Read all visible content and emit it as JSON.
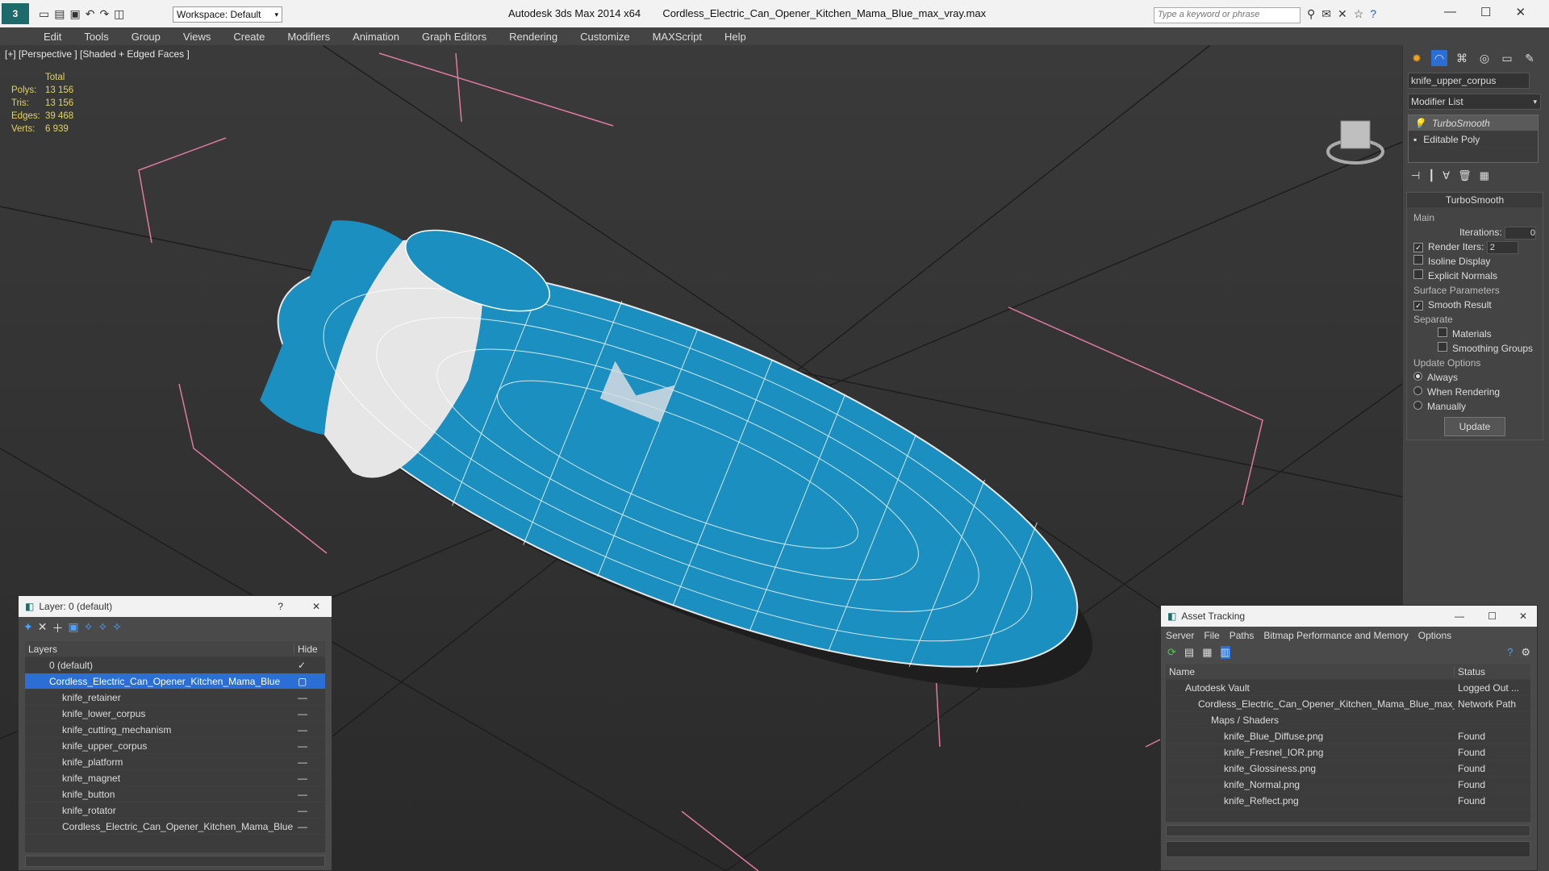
{
  "titlebar": {
    "app": "Autodesk 3ds Max  2014 x64",
    "file": "Cordless_Electric_Can_Opener_Kitchen_Mama_Blue_max_vray.max",
    "workspace": "Workspace: Default",
    "search_placeholder": "Type a keyword or phrase"
  },
  "menu": [
    "Edit",
    "Tools",
    "Group",
    "Views",
    "Create",
    "Modifiers",
    "Animation",
    "Graph Editors",
    "Rendering",
    "Customize",
    "MAXScript",
    "Help"
  ],
  "viewport": {
    "label": "[+] [Perspective ] [Shaded + Edged Faces ]",
    "stats": {
      "header": "Total",
      "rows": [
        {
          "k": "Polys:",
          "v": "13 156"
        },
        {
          "k": "Tris:",
          "v": "13 156"
        },
        {
          "k": "Edges:",
          "v": "39 468"
        },
        {
          "k": "Verts:",
          "v": "6 939"
        }
      ]
    }
  },
  "colors": {
    "accent_blue": "#1a8fc0",
    "selection": "#2b6fd6",
    "viewport_border": "#caa53a",
    "stats_text": "#e3d35a"
  },
  "cmd": {
    "object_name": "knife_upper_corpus",
    "modifier_list": "Modifier List",
    "stack": [
      "TurboSmooth",
      "Editable Poly"
    ],
    "rollout_title": "TurboSmooth",
    "main_label": "Main",
    "iterations_label": "Iterations:",
    "iterations_value": "0",
    "render_iters_label": "Render Iters:",
    "render_iters_value": "2",
    "isoline": "Isoline Display",
    "explicit": "Explicit Normals",
    "surface_params": "Surface Parameters",
    "smooth_result": "Smooth Result",
    "separate": "Separate",
    "materials": "Materials",
    "smoothing_groups": "Smoothing Groups",
    "update_options": "Update Options",
    "always": "Always",
    "when_rendering": "When Rendering",
    "manually": "Manually",
    "update_btn": "Update"
  },
  "layers": {
    "title": "Layer: 0 (default)",
    "col_layers": "Layers",
    "col_hide": "Hide",
    "items": [
      {
        "label": "0 (default)"
      },
      {
        "label": "Cordless_Electric_Can_Opener_Kitchen_Mama_Blue"
      },
      {
        "label": "knife_retainer"
      },
      {
        "label": "knife_lower_corpus"
      },
      {
        "label": "knife_cutting_mechanism"
      },
      {
        "label": "knife_upper_corpus"
      },
      {
        "label": "knife_platform"
      },
      {
        "label": "knife_magnet"
      },
      {
        "label": "knife_button"
      },
      {
        "label": "knife_rotator"
      },
      {
        "label": "Cordless_Electric_Can_Opener_Kitchen_Mama_Blue"
      }
    ]
  },
  "assets": {
    "title": "Asset Tracking",
    "menu": [
      "Server",
      "File",
      "Paths",
      "Bitmap Performance and Memory",
      "Options"
    ],
    "col_name": "Name",
    "col_status": "Status",
    "rows": [
      {
        "name": "Autodesk Vault",
        "status": "Logged Out ..."
      },
      {
        "name": "Cordless_Electric_Can_Opener_Kitchen_Mama_Blue_max_...",
        "status": "Network Path"
      },
      {
        "name": "Maps / Shaders",
        "status": ""
      },
      {
        "name": "knife_Blue_Diffuse.png",
        "status": "Found"
      },
      {
        "name": "knife_Fresnel_IOR.png",
        "status": "Found"
      },
      {
        "name": "knife_Glossiness.png",
        "status": "Found"
      },
      {
        "name": "knife_Normal.png",
        "status": "Found"
      },
      {
        "name": "knife_Reflect.png",
        "status": "Found"
      }
    ]
  }
}
